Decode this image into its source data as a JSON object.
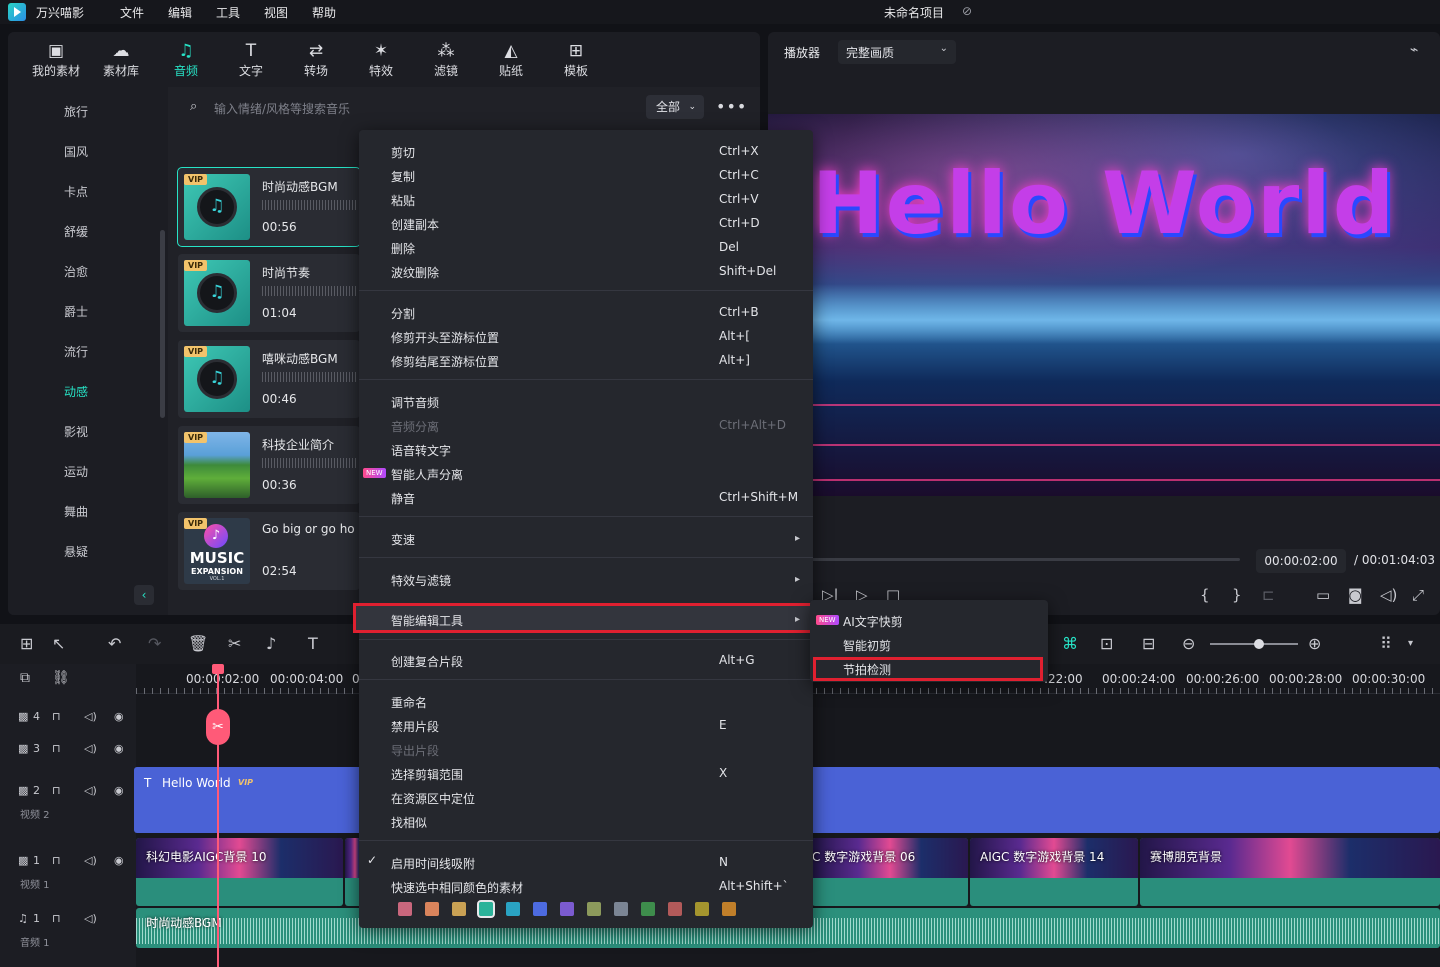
{
  "app": {
    "name": "万兴喵影",
    "project_title": "未命名项目"
  },
  "menubar": [
    "文件",
    "编辑",
    "工具",
    "视图",
    "帮助"
  ],
  "toolbar": [
    {
      "label": "我的素材",
      "icon": "folder-icon"
    },
    {
      "label": "素材库",
      "icon": "cloud-icon"
    },
    {
      "label": "音频",
      "icon": "music-icon",
      "active": true
    },
    {
      "label": "文字",
      "icon": "text-icon"
    },
    {
      "label": "转场",
      "icon": "transition-icon"
    },
    {
      "label": "特效",
      "icon": "effects-icon"
    },
    {
      "label": "滤镜",
      "icon": "filter-icon"
    },
    {
      "label": "贴纸",
      "icon": "sticker-icon"
    },
    {
      "label": "模板",
      "icon": "template-icon"
    }
  ],
  "categories": [
    "旅行",
    "国风",
    "卡点",
    "舒缓",
    "治愈",
    "爵士",
    "流行",
    "动感",
    "影视",
    "运动",
    "舞曲",
    "悬疑"
  ],
  "active_category": "动感",
  "search": {
    "placeholder": "输入情绪/风格等搜索音乐",
    "filter": "全部"
  },
  "section_title": "动感",
  "tracks": [
    {
      "title": "时尚动感BGM",
      "duration": "00:56",
      "vip": "VIP"
    },
    {
      "title": "时尚节奏",
      "duration": "01:04",
      "vip": "VIP"
    },
    {
      "title": "嘻咪动感BGM",
      "duration": "00:46",
      "vip": "VIP"
    },
    {
      "title": "科技企业简介",
      "duration": "00:36",
      "vip": "VIP"
    },
    {
      "title": "Go big or go ho",
      "duration": "02:54",
      "vip": "VIP",
      "cover_text": "MUSIC",
      "cover_sub": "EXPANSION",
      "cover_vol": "VOL.1"
    }
  ],
  "player": {
    "label": "播放器",
    "quality": "完整画质",
    "preview_text": "Hello World",
    "current_time": "00:00:02:00",
    "total_time": "/ 00:01:04:03"
  },
  "timeline": {
    "ruler_labels": [
      "00:00:02:00",
      "00:00:04:00",
      "0",
      ":22:00",
      "00:00:24:00",
      "00:00:26:00",
      "00:00:28:00",
      "00:00:30:00"
    ],
    "track_numbers": [
      "4",
      "3",
      "2",
      "1",
      "1"
    ],
    "track_labels": {
      "video2": "视频 2",
      "video1": "视频 1",
      "audio1": "音频 1"
    },
    "title_clip": {
      "label": "Hello World",
      "vip": "VIP"
    },
    "video_clips": [
      "科幻电影AIGC背景 10",
      "C 数字游戏背景 06",
      "AIGC 数字游戏背景 14",
      "赛博朋克背景"
    ],
    "audio_clip": "时尚动感BGM"
  },
  "context_menu": {
    "groups": [
      [
        {
          "label": "剪切",
          "shortcut": "Ctrl+X"
        },
        {
          "label": "复制",
          "shortcut": "Ctrl+C"
        },
        {
          "label": "粘贴",
          "shortcut": "Ctrl+V"
        },
        {
          "label": "创建副本",
          "shortcut": "Ctrl+D"
        },
        {
          "label": "删除",
          "shortcut": "Del"
        },
        {
          "label": "波纹删除",
          "shortcut": "Shift+Del"
        }
      ],
      [
        {
          "label": "分割",
          "shortcut": "Ctrl+B"
        },
        {
          "label": "修剪开头至游标位置",
          "shortcut": "Alt+["
        },
        {
          "label": "修剪结尾至游标位置",
          "shortcut": "Alt+]"
        }
      ],
      [
        {
          "label": "调节音频",
          "shortcut": ""
        },
        {
          "label": "音频分离",
          "shortcut": "Ctrl+Alt+D",
          "disabled": true
        },
        {
          "label": "语音转文字",
          "shortcut": ""
        },
        {
          "label": "智能人声分离",
          "shortcut": "",
          "new": "NEW"
        },
        {
          "label": "静音",
          "shortcut": "Ctrl+Shift+M"
        }
      ],
      [
        {
          "label": "变速",
          "submenu": true
        }
      ],
      [
        {
          "label": "特效与滤镜",
          "submenu": true
        }
      ],
      [
        {
          "label": "智能编辑工具",
          "submenu": true,
          "highlighted": true
        }
      ],
      [
        {
          "label": "创建复合片段",
          "shortcut": "Alt+G"
        }
      ],
      [
        {
          "label": "重命名",
          "shortcut": ""
        },
        {
          "label": "禁用片段",
          "shortcut": "E"
        },
        {
          "label": "导出片段",
          "shortcut": "",
          "disabled": true
        },
        {
          "label": "选择剪辑范围",
          "shortcut": "X"
        },
        {
          "label": "在资源区中定位",
          "shortcut": ""
        },
        {
          "label": "找相似",
          "shortcut": ""
        }
      ],
      [
        {
          "label": "启用时间线吸附",
          "shortcut": "N",
          "checked": true
        },
        {
          "label": "快速选中相同颜色的素材",
          "shortcut": "Alt+Shift+`"
        }
      ]
    ],
    "color_swatches": [
      "#c9677d",
      "#d9845c",
      "#c9a154",
      "#2bb39a",
      "#2aa3c3",
      "#4d6be0",
      "#7b5bd0",
      "#8c9a5c",
      "#7b8594",
      "#3e8d4c",
      "#b25a5a",
      "#a4952e",
      "#c07f2a"
    ]
  },
  "submenu": {
    "items": [
      {
        "label": "AI文字快剪",
        "new": "NEW"
      },
      {
        "label": "智能初剪"
      },
      {
        "label": "节拍检测",
        "highlighted": true
      }
    ]
  }
}
